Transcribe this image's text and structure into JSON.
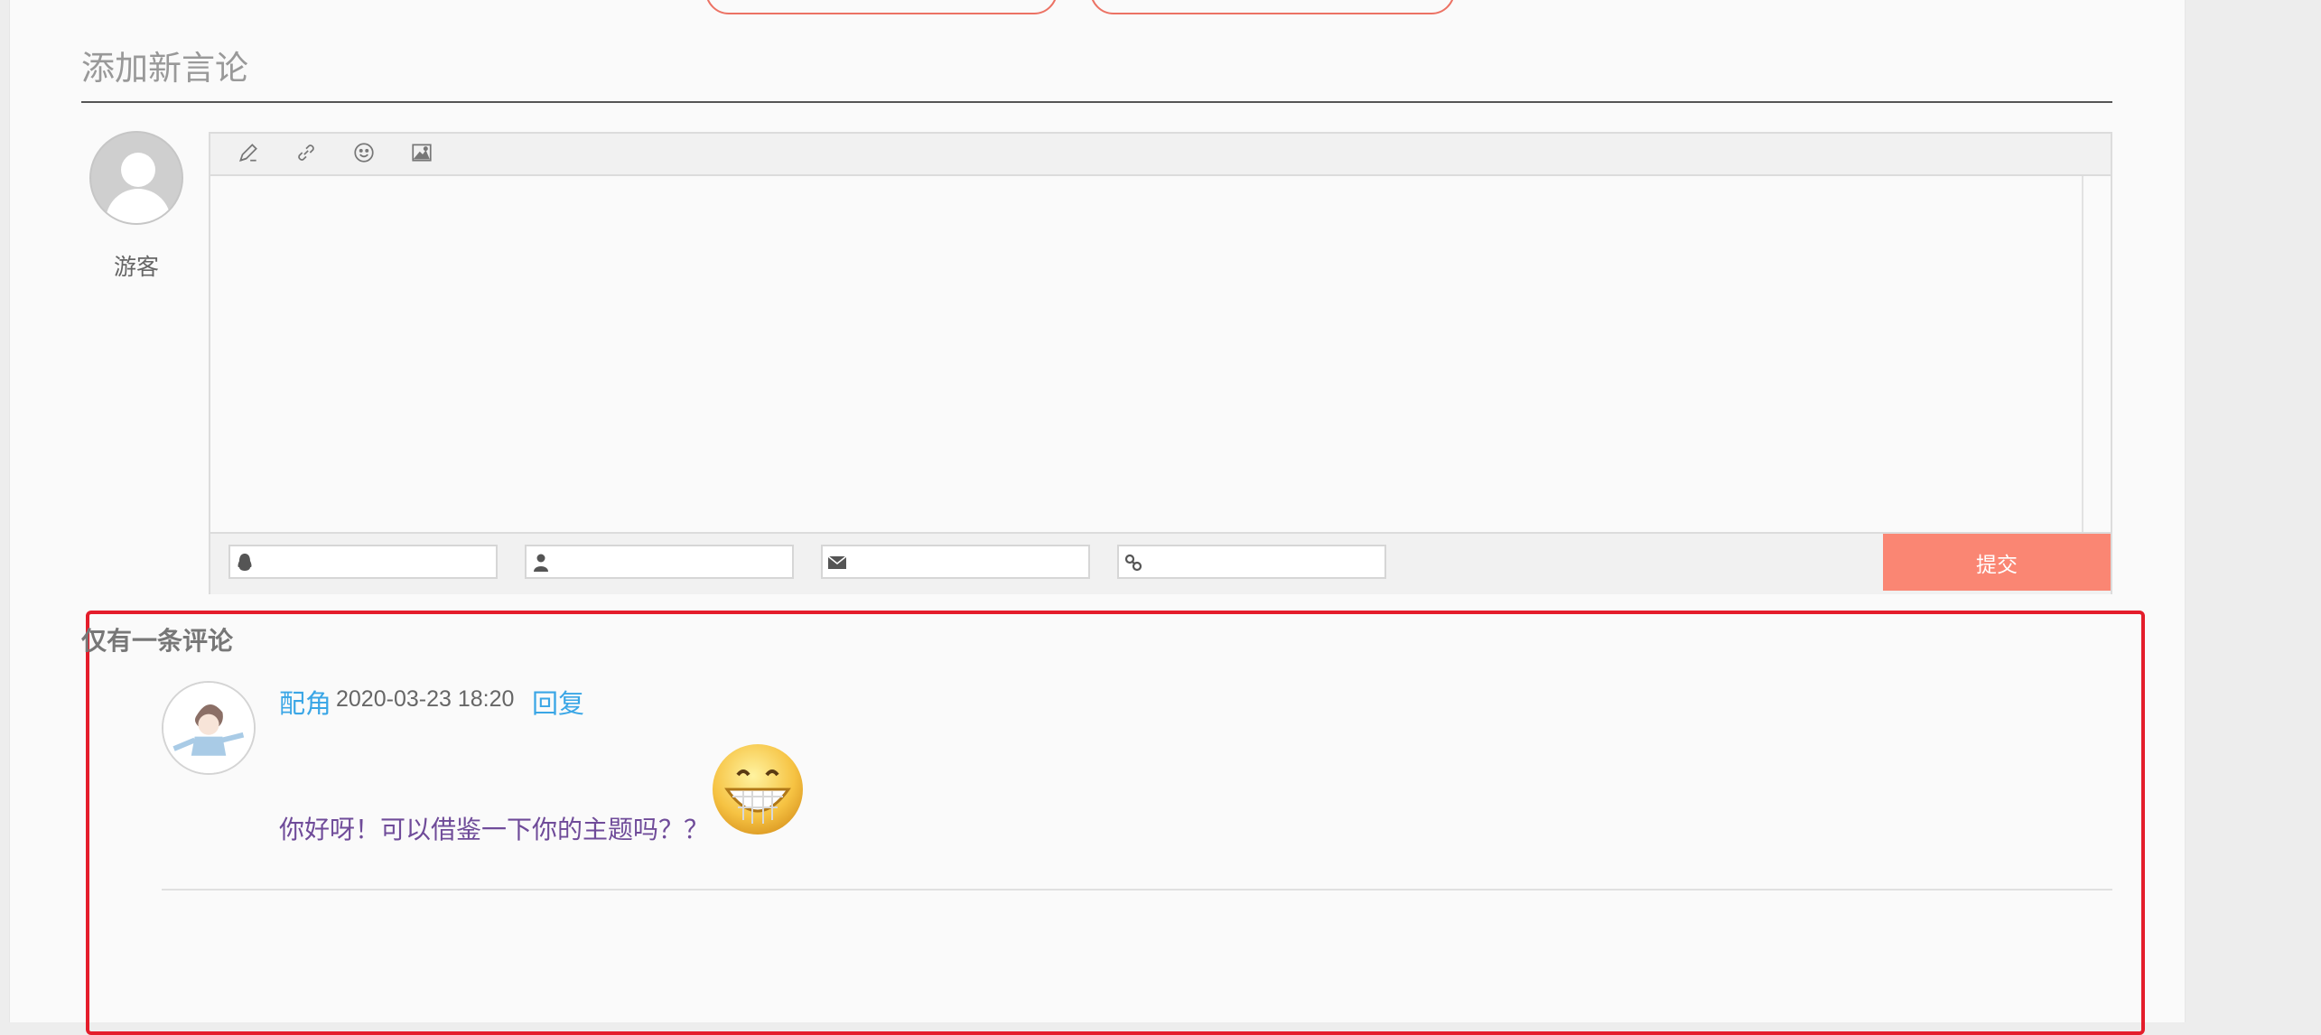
{
  "section": {
    "title": "添加新言论"
  },
  "guest": {
    "name": "游客"
  },
  "editor": {
    "toolbar": [
      {
        "name": "pen-icon"
      },
      {
        "name": "link-icon"
      },
      {
        "name": "smiley-icon"
      },
      {
        "name": "image-icon"
      }
    ],
    "body_value": "",
    "fields": [
      {
        "icon": "qq-icon",
        "value": ""
      },
      {
        "icon": "user-icon",
        "value": ""
      },
      {
        "icon": "mail-icon",
        "value": ""
      },
      {
        "icon": "link-icon",
        "value": ""
      }
    ],
    "submit_label": "提交"
  },
  "comments": {
    "title": "仅有一条评论",
    "items": [
      {
        "author": "配角",
        "time": "2020-03-23 18:20",
        "reply_label": "回复",
        "text": "你好呀！可以借鉴一下你的主题吗？？",
        "emoji": "grinning-emoji"
      }
    ]
  },
  "colors": {
    "accent": "#fa8673",
    "link": "#3aa6e6",
    "comment_text": "#6f4b99",
    "highlight_border": "#e41d2b"
  }
}
